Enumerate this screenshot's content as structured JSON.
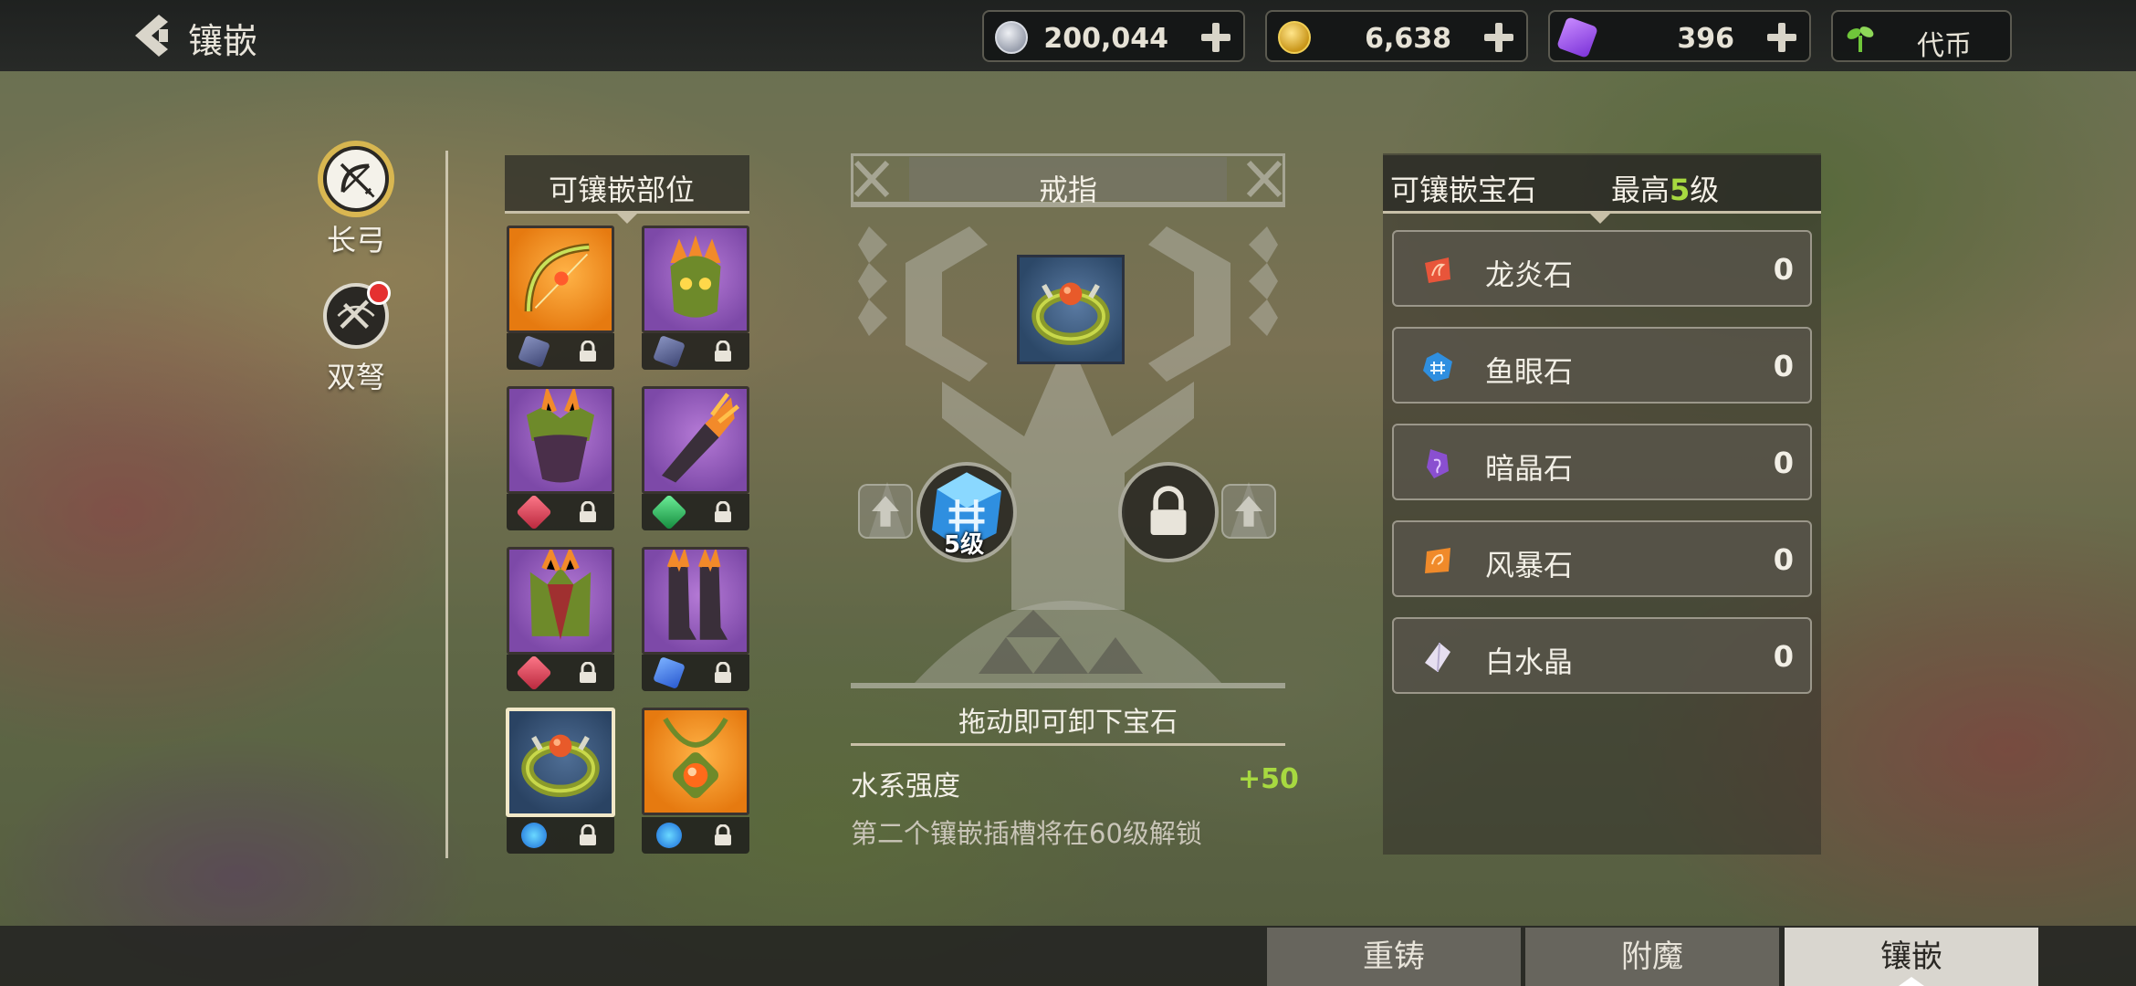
{
  "header": {
    "title": "镶嵌"
  },
  "currencies": [
    {
      "name": "silver-coin",
      "value": "200,044"
    },
    {
      "name": "gold-coin",
      "value": "6,638"
    },
    {
      "name": "purple-gem",
      "value": "396"
    },
    {
      "name": "token",
      "label": "代币"
    }
  ],
  "weapons": [
    {
      "label": "长弓",
      "icon": "longbow-icon",
      "selected": true
    },
    {
      "label": "双弩",
      "icon": "dual-crossbow-icon",
      "notification": true
    }
  ],
  "slots_panel": {
    "title": "可镶嵌部位",
    "slots": [
      {
        "item": "bow",
        "bg": "orange",
        "gem": "purple"
      },
      {
        "item": "helmet",
        "bg": "purple",
        "gem": "purple"
      },
      {
        "item": "chest",
        "bg": "purple",
        "gem": "red"
      },
      {
        "item": "gloves",
        "bg": "purple",
        "gem": "green"
      },
      {
        "item": "cloak",
        "bg": "purple",
        "gem": "red"
      },
      {
        "item": "boots",
        "bg": "purple",
        "gem": "blue"
      },
      {
        "item": "ring",
        "bg": "blue",
        "gem": "cyan",
        "selected": true
      },
      {
        "item": "amulet",
        "bg": "orange",
        "gem": "cyan"
      }
    ]
  },
  "center": {
    "title": "戒指",
    "gem_level": "5级",
    "drag_hint": "拖动即可卸下宝石",
    "stat_label": "水系强度",
    "stat_value": "+50",
    "unlock_note": "第二个镶嵌插槽将在60级解锁"
  },
  "gem_list": {
    "title": "可镶嵌宝石",
    "max_prefix": "最高",
    "max_value": "5",
    "max_suffix": "级",
    "gems": [
      {
        "name": "龙炎石",
        "count": "0",
        "color": "#e8553a"
      },
      {
        "name": "鱼眼石",
        "count": "0",
        "color": "#2f8fe0"
      },
      {
        "name": "暗晶石",
        "count": "0",
        "color": "#8a4fd0"
      },
      {
        "name": "风暴石",
        "count": "0",
        "color": "#f08a2a"
      },
      {
        "name": "白水晶",
        "count": "0",
        "color": "#e6dff0"
      }
    ]
  },
  "tabs": [
    {
      "label": "重铸"
    },
    {
      "label": "附魔"
    },
    {
      "label": "镶嵌",
      "active": true
    }
  ]
}
